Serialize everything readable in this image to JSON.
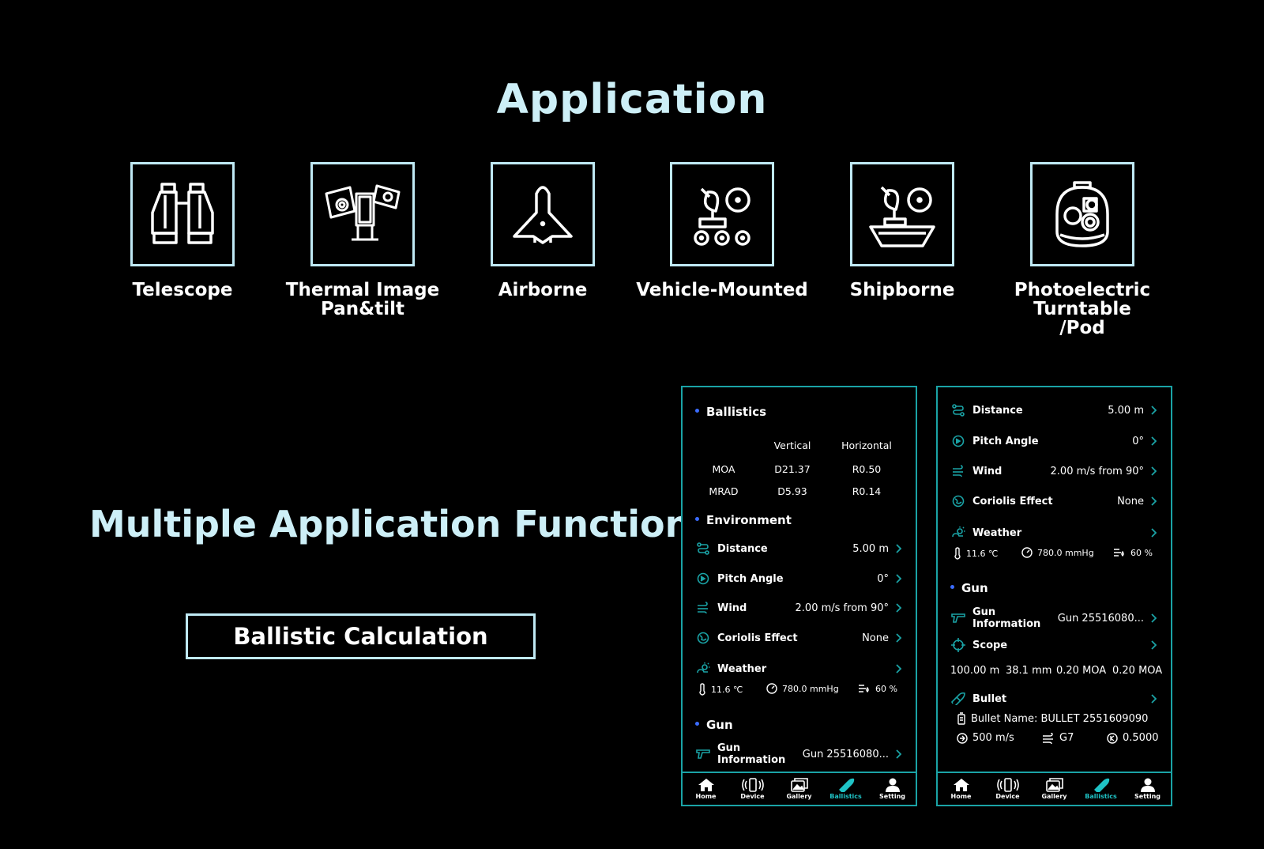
{
  "title": "Application",
  "apps": [
    {
      "label": "Telescope",
      "icon": "binoculars-icon"
    },
    {
      "label": "Thermal Image\nPan&tilt",
      "icon": "pan-tilt-camera-icon"
    },
    {
      "label": "Airborne",
      "icon": "aircraft-icon"
    },
    {
      "label": "Vehicle-Mounted",
      "icon": "vehicle-radar-icon"
    },
    {
      "label": "Shipborne",
      "icon": "ship-radar-icon"
    },
    {
      "label": "Photoelectric\nTurntable\n/Pod",
      "icon": "gimbal-pod-icon"
    }
  ],
  "headline": "Multiple Application Function",
  "button_label": "Ballistic Calculation",
  "colors": {
    "accent": "#1aa3a6",
    "dot": "#3b6cff",
    "title": "#cdeff7",
    "frame": "#bfe9f4",
    "active": "#1fc3c6"
  },
  "phone1": {
    "ballistics": "Ballistics",
    "vertical": "Vertical",
    "horizontal": "Horizontal",
    "moa": "MOA",
    "moa_v": "D21.37",
    "moa_h": "R0.50",
    "mrad": "MRAD",
    "mrad_v": "D5.93",
    "mrad_h": "R0.14",
    "environment": "Environment",
    "distance": "Distance",
    "distance_v": "5.00 m",
    "pitch": "Pitch Angle",
    "pitch_v": "0°",
    "wind": "Wind",
    "wind_v": "2.00 m/s from 90°",
    "coriolis": "Coriolis Effect",
    "coriolis_v": "None",
    "weather": "Weather",
    "temp": "11.6 ℃",
    "pressure": "780.0 mmHg",
    "humidity": "60 %",
    "gun": "Gun",
    "gun_info": "Gun Information",
    "gun_info_v": "Gun 25516080..."
  },
  "phone2": {
    "distance": "Distance",
    "distance_v": "5.00 m",
    "pitch": "Pitch Angle",
    "pitch_v": "0°",
    "wind": "Wind",
    "wind_v": "2.00 m/s from 90°",
    "coriolis": "Coriolis Effect",
    "coriolis_v": "None",
    "weather": "Weather",
    "temp": "11.6 ℃",
    "pressure": "780.0 mmHg",
    "humidity": "60 %",
    "gun": "Gun",
    "gun_info": "Gun Information",
    "gun_info_v": "Gun 25516080...",
    "scope": "Scope",
    "scope_vals": [
      "100.00 m",
      "38.1 mm",
      "0.20 MOA",
      "0.20 MOA"
    ],
    "bullet": "Bullet",
    "bullet_name": "Bullet Name: BULLET 2551609090",
    "velocity": "500 m/s",
    "drag": "G7",
    "bc": "0.5000"
  },
  "nav": [
    {
      "label": "Home",
      "icon": "home-icon"
    },
    {
      "label": "Device",
      "icon": "device-icon"
    },
    {
      "label": "Gallery",
      "icon": "gallery-icon"
    },
    {
      "label": "Ballistics",
      "icon": "bullet-icon",
      "active": true
    },
    {
      "label": "Setting",
      "icon": "person-icon"
    }
  ]
}
